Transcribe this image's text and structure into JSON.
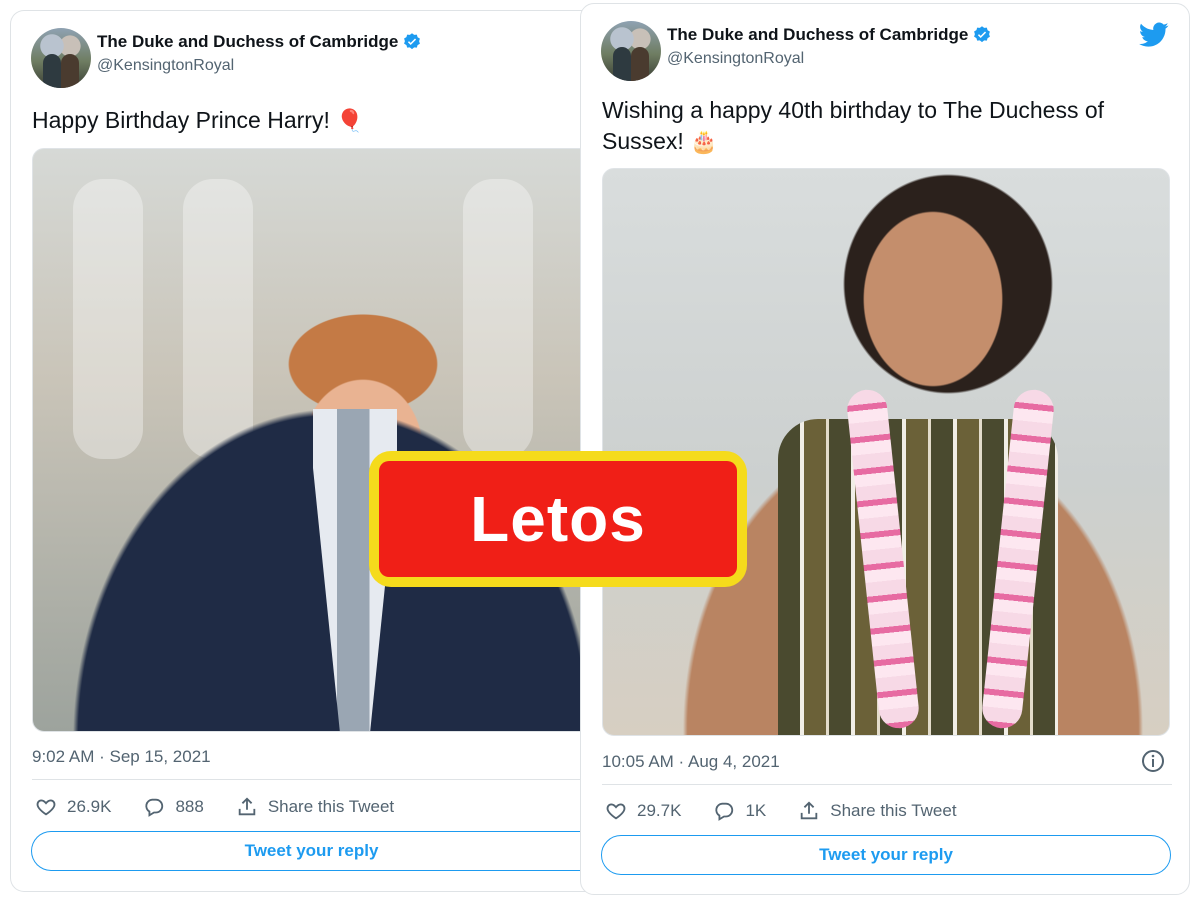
{
  "tweets": [
    {
      "author": {
        "name": "The Duke and Duchess of Cambridge",
        "handle": "@KensingtonRoyal"
      },
      "text": "Happy Birthday Prince Harry!",
      "emoji": "🎈",
      "timestamp": "9:02 AM · Sep 15, 2021",
      "likes": "26.9K",
      "replies": "888",
      "share_label": "Share this Tweet",
      "reply_label": "Tweet your reply"
    },
    {
      "author": {
        "name": "The Duke and Duchess of Cambridge",
        "handle": "@KensingtonRoyal"
      },
      "text": "Wishing a happy 40th birthday to The Duchess of Sussex!",
      "emoji": "🎂",
      "timestamp": "10:05 AM · Aug 4, 2021",
      "likes": "29.7K",
      "replies": "1K",
      "share_label": "Share this Tweet",
      "reply_label": "Tweet your reply"
    }
  ],
  "stamp": {
    "label": "Letos"
  },
  "colors": {
    "accent": "#1d9bf0",
    "stamp_fill": "#f01f17",
    "stamp_border": "#f5db1c",
    "muted": "#536471"
  },
  "icons": [
    "verified-badge-icon",
    "heart-icon",
    "reply-bubble-icon",
    "share-icon",
    "twitter-bird-icon",
    "info-icon"
  ]
}
